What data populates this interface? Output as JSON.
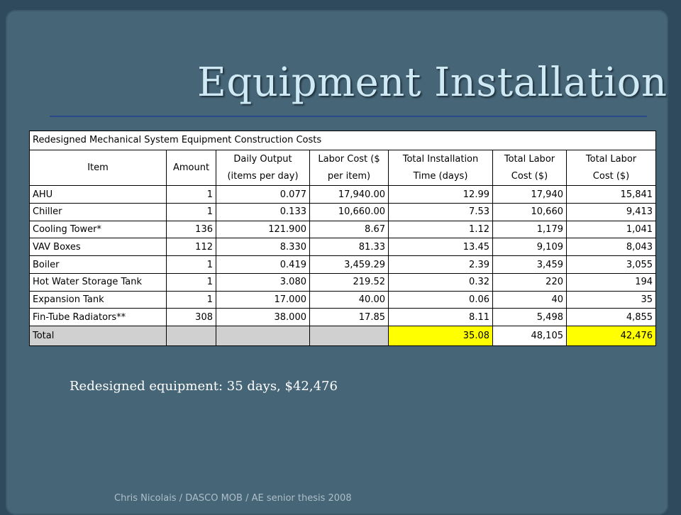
{
  "slide": {
    "title": "Equipment Installation",
    "subtitle": "Redesigned equipment: 35 days, $42,476",
    "footer": "Chris Nicolais / DASCO MOB / AE senior thesis 2008"
  },
  "table": {
    "caption": "Redesigned Mechanical System Equipment Construction Costs",
    "headers": [
      [
        "",
        "Item"
      ],
      [
        "",
        "Amount"
      ],
      [
        "Daily Output",
        "(items per day)"
      ],
      [
        "Labor Cost ($",
        "per item)"
      ],
      [
        "Total Installation",
        "Time (days)"
      ],
      [
        "Total Labor",
        "Cost ($)"
      ],
      [
        "Total Labor",
        "Cost ($)"
      ]
    ],
    "rows": [
      [
        "AHU",
        "1",
        "0.077",
        "17,940.00",
        "12.99",
        "17,940",
        "15,841"
      ],
      [
        "Chiller",
        "1",
        "0.133",
        "10,660.00",
        "7.53",
        "10,660",
        "9,413"
      ],
      [
        "Cooling Tower*",
        "136",
        "121.900",
        "8.67",
        "1.12",
        "1,179",
        "1,041"
      ],
      [
        "VAV Boxes",
        "112",
        "8.330",
        "81.33",
        "13.45",
        "9,109",
        "8,043"
      ],
      [
        "Boiler",
        "1",
        "0.419",
        "3,459.29",
        "2.39",
        "3,459",
        "3,055"
      ],
      [
        "Hot Water Storage Tank",
        "1",
        "3.080",
        "219.52",
        "0.32",
        "220",
        "194"
      ],
      [
        "Expansion Tank",
        "1",
        "17.000",
        "40.00",
        "0.06",
        "40",
        "35"
      ],
      [
        "Fin-Tube Radiators**",
        "308",
        "38.000",
        "17.85",
        "8.11",
        "5,498",
        "4,855"
      ]
    ],
    "total": [
      "Total",
      "",
      "",
      "",
      "35.08",
      "48,105",
      "42,476"
    ],
    "colors": {
      "highlight": "#ffff00",
      "total_fill": "#d0d0d0"
    }
  }
}
